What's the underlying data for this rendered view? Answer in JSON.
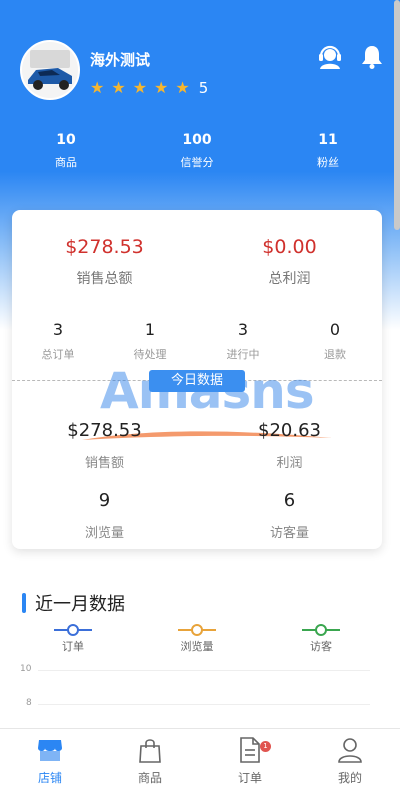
{
  "shop": {
    "name": "海外测试",
    "rating": "5",
    "stars": 5
  },
  "header_icons": [
    "support-icon",
    "bell-icon"
  ],
  "stats": [
    {
      "value": "10",
      "label": "商品"
    },
    {
      "value": "100",
      "label": "信誉分"
    },
    {
      "value": "11",
      "label": "粉丝"
    }
  ],
  "summary": {
    "sales_total": {
      "value": "$278.53",
      "label": "销售总额"
    },
    "profit_total": {
      "value": "$0.00",
      "label": "总利润"
    },
    "orders": [
      {
        "value": "3",
        "label": "总订单"
      },
      {
        "value": "1",
        "label": "待处理"
      },
      {
        "value": "3",
        "label": "进行中"
      },
      {
        "value": "0",
        "label": "退款"
      }
    ],
    "today_label": "今日数据",
    "watermark": "Amasns",
    "today": [
      {
        "value": "$278.53",
        "label": "销售额"
      },
      {
        "value": "$20.63",
        "label": "利润"
      },
      {
        "value": "9",
        "label": "浏览量"
      },
      {
        "value": "6",
        "label": "访客量"
      }
    ]
  },
  "monthly": {
    "title": "近一月数据",
    "legend": [
      {
        "label": "订单",
        "color": "#3b6fd9"
      },
      {
        "label": "浏览量",
        "color": "#e8a33a"
      },
      {
        "label": "访客",
        "color": "#3aa64f"
      }
    ],
    "axis": [
      "10",
      "8"
    ]
  },
  "tabs": [
    {
      "label": "店铺",
      "active": true
    },
    {
      "label": "商品",
      "active": false
    },
    {
      "label": "订单",
      "active": false,
      "badge": "1"
    },
    {
      "label": "我的",
      "active": false
    }
  ],
  "colors": {
    "primary": "#2b86f3",
    "money": "#d0312d",
    "star": "#f5b630",
    "badge": "#e0544f"
  }
}
